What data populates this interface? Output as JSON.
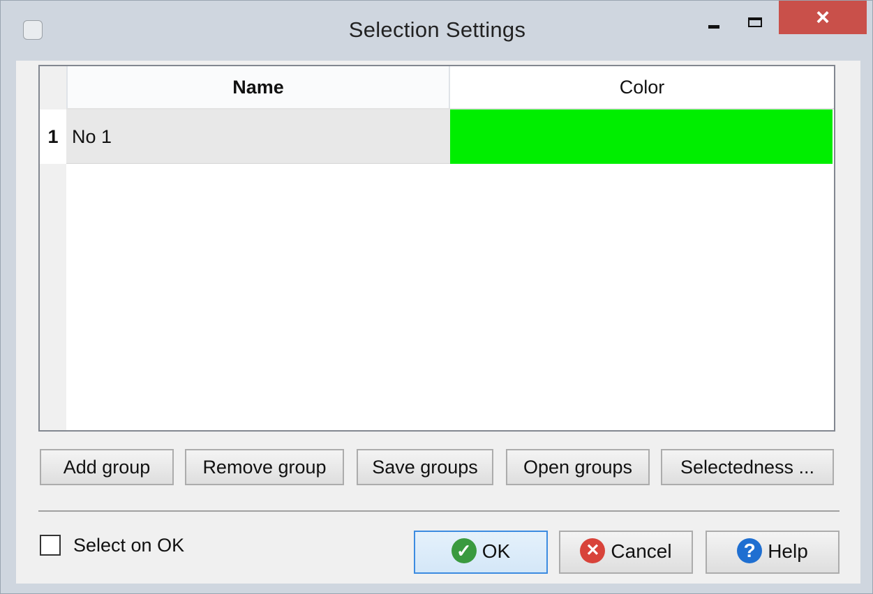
{
  "window": {
    "title": "Selection Settings",
    "close_glyph": "×"
  },
  "table": {
    "columns": [
      "Name",
      "Color"
    ],
    "rows": [
      {
        "index": "1",
        "name": "No 1",
        "color": "#00ee00"
      }
    ]
  },
  "actions": {
    "add_group": "Add group",
    "remove_group": "Remove group",
    "save_groups": "Save groups",
    "open_groups": "Open groups",
    "selectedness": "Selectedness ..."
  },
  "footer": {
    "select_on_ok_label": "Select on OK",
    "select_on_ok_checked": false,
    "ok_label": "OK",
    "cancel_label": "Cancel",
    "help_label": "Help",
    "ok_icon_glyph": "✓",
    "cancel_icon_glyph": "✕",
    "help_icon_glyph": "?"
  }
}
